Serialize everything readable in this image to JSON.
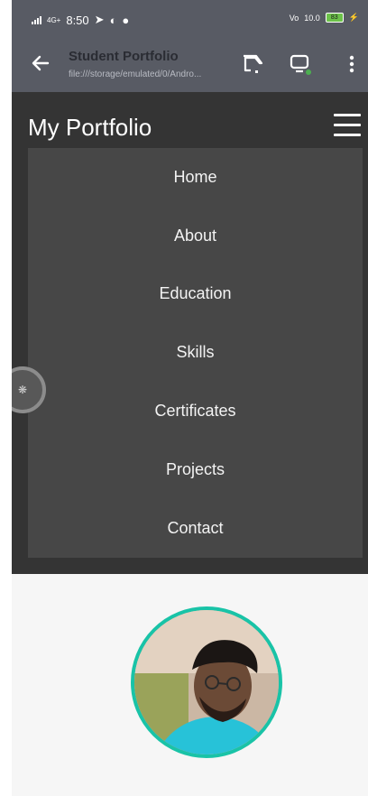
{
  "status_bar": {
    "time": "8:50",
    "network_label": "4G+",
    "right_label_1": "Vo",
    "right_label_2": "10.0",
    "battery": "83"
  },
  "browser": {
    "title": "Student Portfolio",
    "url": "file:///storage/emulated/0/Andro..."
  },
  "site": {
    "brand": "My Portfolio",
    "menu": [
      "Home",
      "About",
      "Education",
      "Skills",
      "Certificates",
      "Projects",
      "Contact"
    ]
  },
  "colors": {
    "header_bg": "#343434",
    "menu_bg": "#474747",
    "browser_bg": "#585b64",
    "accent": "#19c3a7"
  },
  "icons": [
    "back-arrow-icon",
    "cast-icon",
    "device-icon",
    "more-vert-icon",
    "hamburger-icon",
    "sparkle-icon"
  ]
}
